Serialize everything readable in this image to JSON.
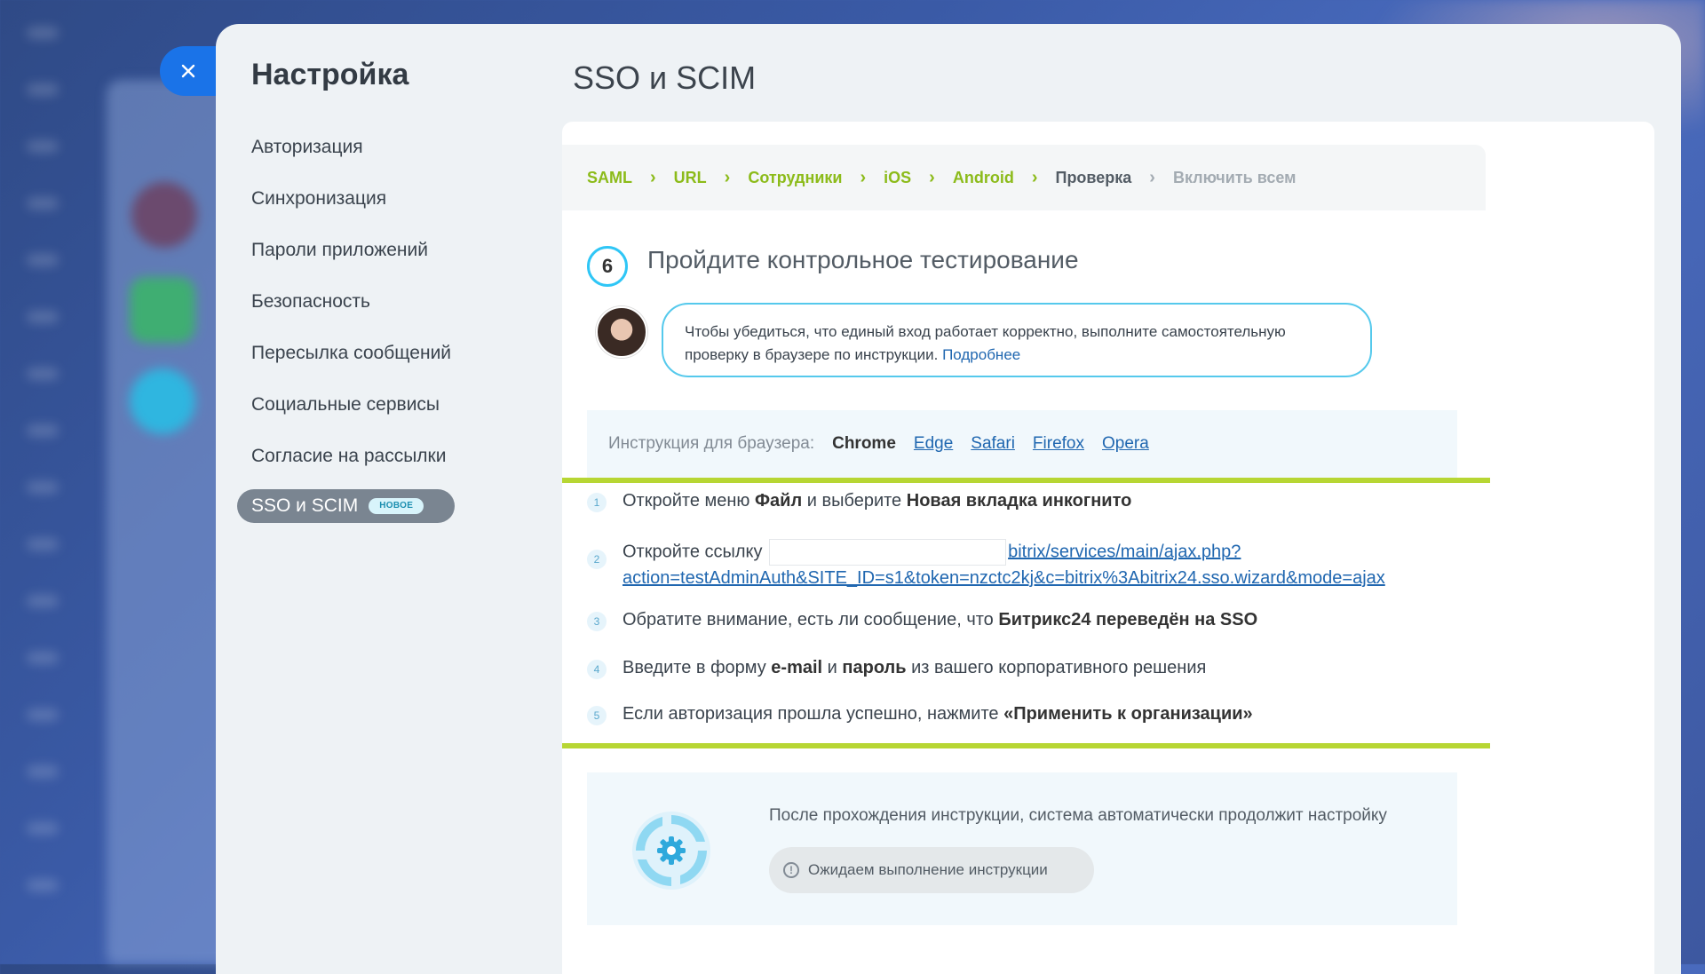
{
  "panel": {
    "menu_title": "Настройка",
    "menu_items": [
      "Авторизация",
      "Синхронизация",
      "Пароли приложений",
      "Безопасность",
      "Пересылка сообщений",
      "Социальные сервисы",
      "Согласие на рассылки"
    ],
    "active_item": {
      "label": "SSO и SCIM",
      "badge": "НОВОЕ"
    }
  },
  "page": {
    "title": "SSO и SCIM"
  },
  "wizard": {
    "steps": [
      {
        "label": "SAML",
        "state": "done"
      },
      {
        "label": "URL",
        "state": "done"
      },
      {
        "label": "Сотрудники",
        "state": "done"
      },
      {
        "label": "iOS",
        "state": "done"
      },
      {
        "label": "Android",
        "state": "done"
      },
      {
        "label": "Проверка",
        "state": "current"
      },
      {
        "label": "Включить всем",
        "state": "todo"
      }
    ],
    "step_number": "6",
    "step_title": "Пройдите контрольное тестирование",
    "hint_text": "Чтобы убедиться, что единый вход работает корректно, выполните самостоятельную проверку в браузере по инструкции.",
    "hint_link": "Подробнее",
    "browser_label": "Инструкция для браузера:",
    "browsers": [
      "Chrome",
      "Edge",
      "Safari",
      "Firefox",
      "Opera"
    ],
    "selected_browser": "Chrome",
    "instructions": {
      "s1": {
        "n": "1",
        "a": "Откройте меню ",
        "b1": "Файл",
        "c": " и выберите ",
        "b2": "Новая вкладка инкогнито"
      },
      "s2": {
        "n": "2",
        "a": "Откройте ссылку",
        "link1": "bitrix/services/main/ajax.php?",
        "link2": "action=testAdminAuth&SITE_ID=s1&token=nzctc2kj&c=bitrix%3Abitrix24.sso.wizard&mode=ajax"
      },
      "s3": {
        "n": "3",
        "a": "Обратите внимание, есть ли сообщение, что ",
        "b1": "Битрикс24 переведён на SSO"
      },
      "s4": {
        "n": "4",
        "a": "Введите в форму ",
        "b1": "e-mail",
        "c": " и ",
        "b2": "пароль",
        "d": " из вашего корпоративного решения"
      },
      "s5": {
        "n": "5",
        "a": "Если авторизация прошла успешно, нажмите ",
        "b1": "«Применить к организации»"
      }
    },
    "status_text": "После прохождения инструкции, система автоматически продолжит настройку",
    "waiting_label": "Ожидаем выполнение инструкции"
  },
  "colors": {
    "accent_green": "#8cbb1a",
    "accent_blue": "#2fc6f6",
    "close_blue": "#1a73e8"
  }
}
